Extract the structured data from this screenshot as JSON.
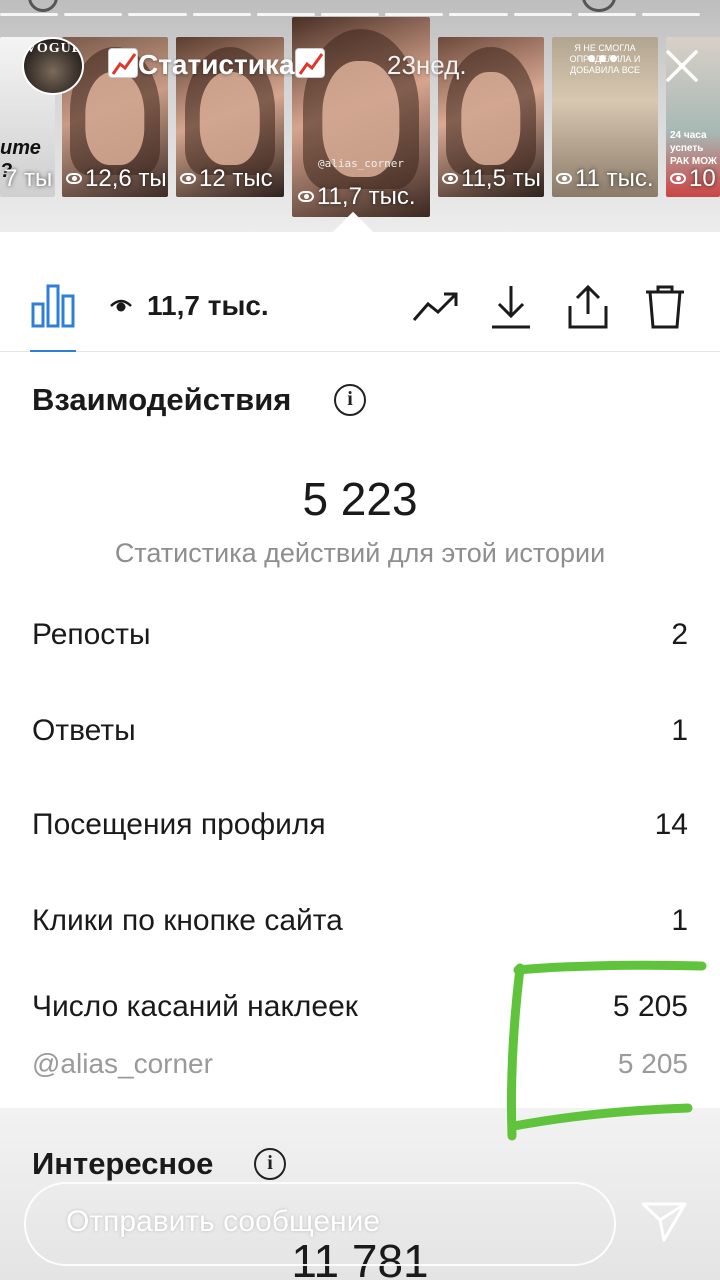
{
  "story_header": {
    "title": "Статистика",
    "time": "23нед.",
    "avatar_text": "VOGUE"
  },
  "thumbnails": [
    {
      "views": "7 ты",
      "overlay_text": "ите ?"
    },
    {
      "views": "12,6 ты"
    },
    {
      "views": "12 тыс"
    },
    {
      "views": "11,7 тыс.",
      "handle": "@alias_corner",
      "selected": true
    },
    {
      "views": "11,5 ты"
    },
    {
      "views": "11 тыс.",
      "overlay_text": "Я НЕ СМОГЛА ОПРЕДЕЛИЛА И ДОБАВИЛА ВСЕ"
    },
    {
      "views": "10",
      "overlay_text": "24 часа успеть РАК МОЖ"
    }
  ],
  "tabbar": {
    "view_count": "11,7 тыс.",
    "icons": [
      "bar-chart-icon",
      "eye-icon",
      "trend-icon",
      "download-icon",
      "share-icon",
      "trash-icon"
    ]
  },
  "interactions": {
    "title": "Взаимодействия",
    "total": "5 223",
    "caption": "Статистика действий для этой истории",
    "rows": [
      {
        "label": "Репосты",
        "value": "2"
      },
      {
        "label": "Ответы",
        "value": "1"
      },
      {
        "label": "Посещения профиля",
        "value": "14"
      },
      {
        "label": "Клики по кнопке сайта",
        "value": "1"
      },
      {
        "label": "Число касаний наклеек",
        "value": "5 205"
      }
    ],
    "sticker_detail": {
      "label": "@alias_corner",
      "value": "5 205"
    }
  },
  "discovery": {
    "title": "Интересное",
    "total_peek": "11 781"
  },
  "reply": {
    "placeholder": "Отправить сообщение"
  },
  "colors": {
    "accent_blue": "#2f7fd8",
    "highlight_green": "#5fc43b",
    "trend_red": "#e0362b"
  }
}
